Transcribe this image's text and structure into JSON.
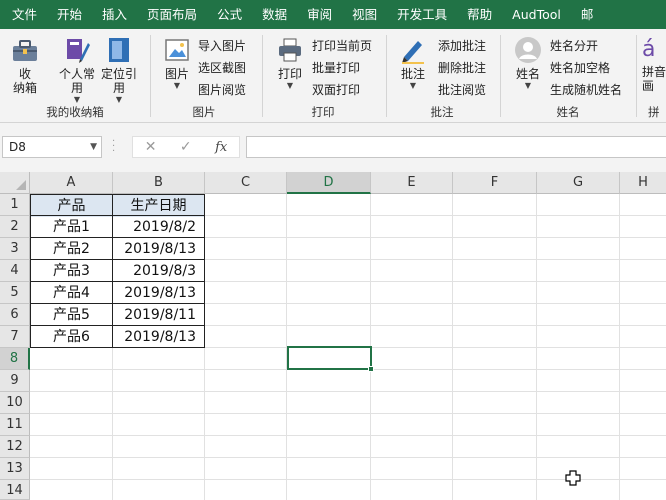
{
  "menu": [
    "文件",
    "开始",
    "插入",
    "页面布局",
    "公式",
    "数据",
    "审阅",
    "视图",
    "开发工具",
    "帮助",
    "AudTool",
    "邮"
  ],
  "ribbon": {
    "g1": {
      "btn1": "收\n纳箱",
      "btn2": "个人常\n用",
      "btn3": "定位引\n用",
      "label": "我的收纳箱"
    },
    "g2": {
      "big": "图片",
      "items": [
        "导入图片",
        "选区截图",
        "图片阅览"
      ],
      "label": "图片"
    },
    "g3": {
      "big": "打印",
      "items": [
        "打印当前页",
        "批量打印",
        "双面打印"
      ],
      "label": "打印"
    },
    "g4": {
      "big": "批注",
      "items": [
        "添加批注",
        "删除批注",
        "批注阅览"
      ],
      "label": "批注"
    },
    "g5": {
      "big": "姓名",
      "items": [
        "姓名分开",
        "姓名加空格",
        "生成随机姓名"
      ],
      "label": "姓名"
    },
    "g6": {
      "big": "拼音\n画",
      "label": "拼"
    }
  },
  "formula_bar": {
    "name_box": "D8",
    "cancel_icon": "✕",
    "enter_icon": "✓",
    "fx_label": "fx",
    "formula": ""
  },
  "columns": [
    "A",
    "B",
    "C",
    "D",
    "E",
    "F",
    "G",
    "H"
  ],
  "rows": [
    "1",
    "2",
    "3",
    "4",
    "5",
    "6",
    "7",
    "8",
    "9",
    "10",
    "11",
    "12",
    "13",
    "14"
  ],
  "selected_cell": "D8",
  "table": {
    "headers": [
      "产品",
      "生产日期"
    ],
    "rows": [
      [
        "产品1",
        "2019/8/2"
      ],
      [
        "产品2",
        "2019/8/13"
      ],
      [
        "产品3",
        "2019/8/3"
      ],
      [
        "产品4",
        "2019/8/13"
      ],
      [
        "产品5",
        "2019/8/11"
      ],
      [
        "产品6",
        "2019/8/13"
      ]
    ]
  },
  "colors": {
    "accent": "#217346",
    "table_header_fill": "#dce6f1"
  }
}
